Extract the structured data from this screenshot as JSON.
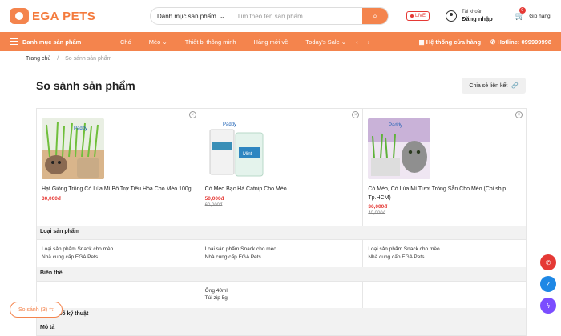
{
  "brand": {
    "name": "EGA PETS",
    "accent": "#f4844d"
  },
  "search": {
    "category": "Danh mục sản phẩm",
    "placeholder": "Tìm theo tên sản phẩm..."
  },
  "header": {
    "live": "LIVE",
    "account_small": "Tài khoản",
    "account_big": "Đăng nhập",
    "cart_count": "0",
    "cart_label": "Giỏ hàng"
  },
  "nav": {
    "menu_label": "Danh mục sản phẩm",
    "links": [
      "Chó",
      "Mèo",
      "Thiết bị thông minh",
      "Hàng mới về",
      "Today's Sale"
    ],
    "store_label": "Hệ thống cửa hàng",
    "hotline_label": "Hotline:",
    "hotline_number": "099999998"
  },
  "breadcrumb": {
    "home": "Trang chủ",
    "current": "So sánh sản phẩm"
  },
  "page": {
    "title": "So sánh sản phẩm",
    "share_label": "Chia sẻ liên kết"
  },
  "products": [
    {
      "name": "Hạt Giống Trồng Cỏ Lúa Mì Bổ Trợ Tiêu Hóa Cho Mèo 100g",
      "price": "30,000đ",
      "old_price": ""
    },
    {
      "name": "Cỏ Mèo Bạc Hà Catnip Cho Mèo",
      "price": "50,000đ",
      "old_price": "60,000đ"
    },
    {
      "name": "Cỏ Mèo, Cỏ Lúa Mì Tươi Trồng Sẵn Cho Mèo (Chỉ ship Tp.HCM)",
      "price": "36,000đ",
      "old_price": "40,000đ"
    }
  ],
  "sections": {
    "type": "Loại sản phẩm",
    "variant": "Biến thể",
    "specs": "Thông số kỹ thuật",
    "desc": "Mô tả"
  },
  "type_rows": [
    [
      "Loại sản phẩm Snack cho mèo",
      "Nhà cung cấp EGA Pets"
    ],
    [
      "Loại sản phẩm Snack cho mèo",
      "Nhà cung cấp EGA Pets"
    ],
    [
      "Loại sản phẩm Snack cho mèo",
      "Nhà cung cấp EGA Pets"
    ]
  ],
  "variant_rows": [
    [
      "",
      ""
    ],
    [
      "Ống 40ml",
      "Túi zip 5g"
    ],
    [
      "",
      ""
    ]
  ],
  "compare_pill": "So sánh (3)"
}
